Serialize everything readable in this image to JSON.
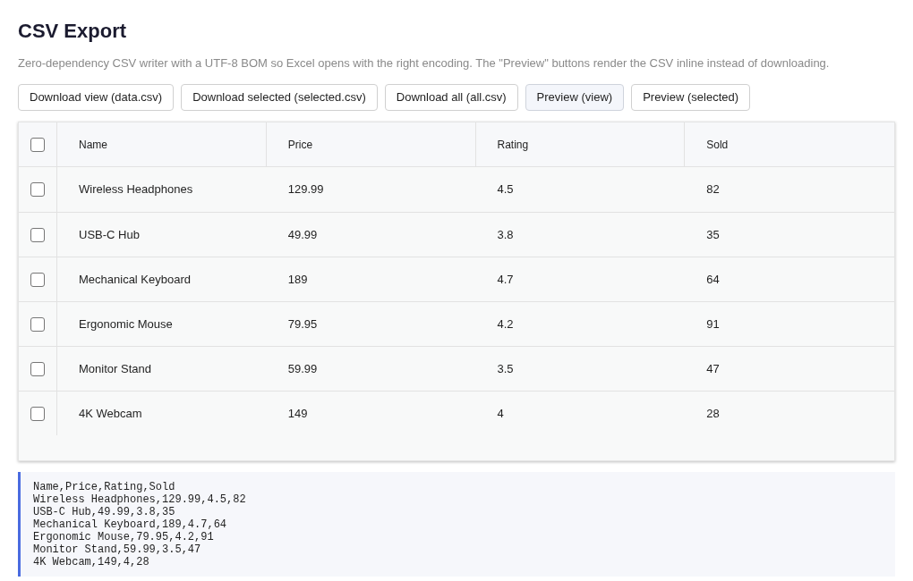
{
  "title": "CSV Export",
  "description": "Zero-dependency CSV writer with a UTF-8 BOM so Excel opens with the right encoding. The \"Preview\" buttons render the CSV inline instead of downloading.",
  "buttons": [
    {
      "label": "Download view (data.csv)",
      "active": false
    },
    {
      "label": "Download selected (selected.csv)",
      "active": false
    },
    {
      "label": "Download all (all.csv)",
      "active": false
    },
    {
      "label": "Preview (view)",
      "active": true
    },
    {
      "label": "Preview (selected)",
      "active": false
    }
  ],
  "table": {
    "select_all": {
      "checked": false
    },
    "columns": [
      "Name",
      "Price",
      "Rating",
      "Sold"
    ],
    "rows": [
      {
        "checked": false,
        "cells": [
          "Wireless Headphones",
          "129.99",
          "4.5",
          "82"
        ]
      },
      {
        "checked": false,
        "cells": [
          "USB-C Hub",
          "49.99",
          "3.8",
          "35"
        ]
      },
      {
        "checked": false,
        "cells": [
          "Mechanical Keyboard",
          "189",
          "4.7",
          "64"
        ]
      },
      {
        "checked": false,
        "cells": [
          "Ergonomic Mouse",
          "79.95",
          "4.2",
          "91"
        ]
      },
      {
        "checked": false,
        "cells": [
          "Monitor Stand",
          "59.99",
          "3.5",
          "47"
        ]
      },
      {
        "checked": false,
        "cells": [
          "4K Webcam",
          "149",
          "4",
          "28"
        ]
      }
    ]
  },
  "preview": {
    "lines": [
      "Name,Price,Rating,Sold",
      "Wireless Headphones,129.99,4.5,82",
      "USB-C Hub,49.99,3.8,35",
      "Mechanical Keyboard,189,4.7,64",
      "Ergonomic Mouse,79.95,4.2,91",
      "Monitor Stand,59.99,3.5,47",
      "4K Webcam,149,4,28"
    ]
  }
}
